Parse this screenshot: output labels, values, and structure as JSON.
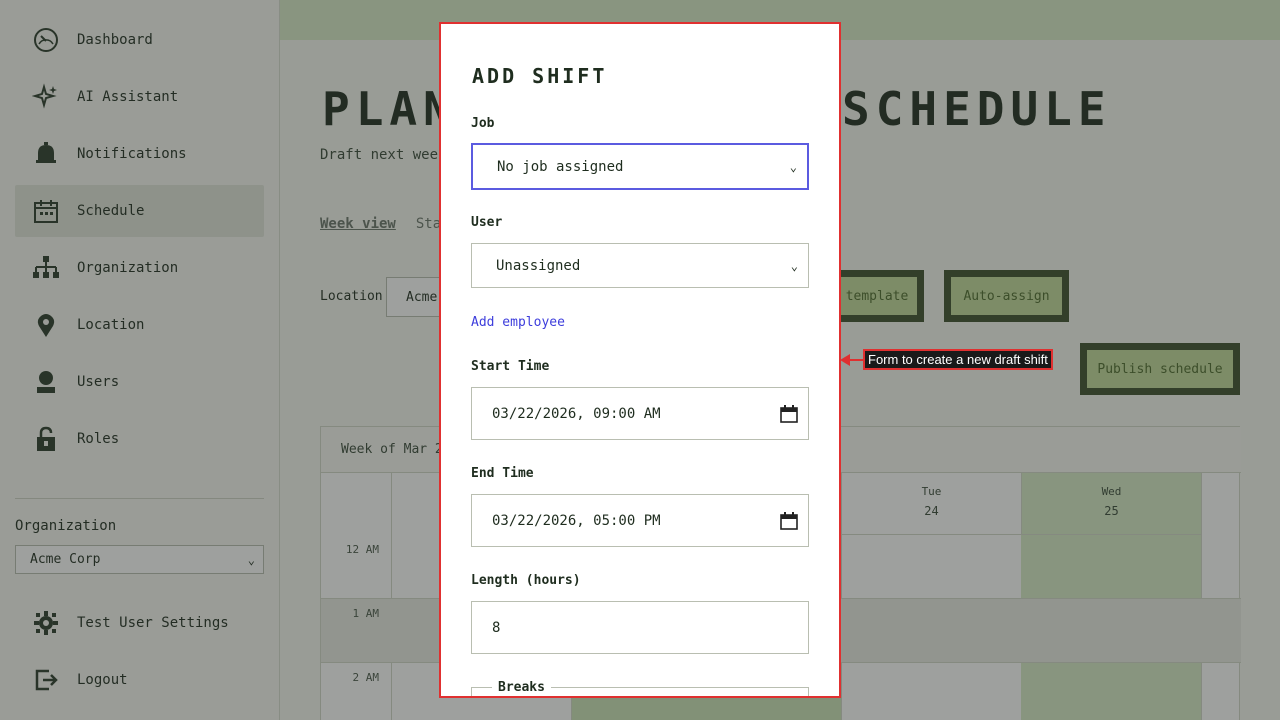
{
  "sidebar": {
    "items": [
      {
        "label": "Dashboard",
        "icon": "dashboard-icon"
      },
      {
        "label": "AI Assistant",
        "icon": "sparkle-icon"
      },
      {
        "label": "Notifications",
        "icon": "bell-icon"
      },
      {
        "label": "Schedule",
        "icon": "calendar-icon",
        "active": true
      },
      {
        "label": "Organization",
        "icon": "org-chart-icon"
      },
      {
        "label": "Location",
        "icon": "location-pin-icon"
      },
      {
        "label": "Users",
        "icon": "user-icon"
      },
      {
        "label": "Roles",
        "icon": "lock-icon"
      }
    ],
    "org_label": "Organization",
    "org_value": "Acme Corp",
    "settings_label": "Test User Settings",
    "logout_label": "Logout"
  },
  "main": {
    "title_left": "PLAN",
    "title_right": "SCHEDULE",
    "subtitle": "Draft next week",
    "tabs": [
      "Week view",
      "Staf"
    ],
    "location_label": "Location",
    "location_value": "Acme",
    "buttons": {
      "template": "template",
      "auto_assign": "Auto-assign",
      "publish": "Publish schedule"
    },
    "week_label": "Week of Mar 22",
    "days": [
      {
        "name": "Tue",
        "num": "24"
      },
      {
        "name": "Wed",
        "num": "25"
      }
    ],
    "hours": [
      "12 AM",
      "1 AM",
      "2 AM"
    ]
  },
  "modal": {
    "title": "ADD SHIFT",
    "job_label": "Job",
    "job_value": "No job assigned",
    "user_label": "User",
    "user_value": "Unassigned",
    "add_employee": "Add employee",
    "start_label": "Start Time",
    "start_value": "03/22/2026, 09:00 AM",
    "end_label": "End Time",
    "end_value": "03/22/2026, 05:00 PM",
    "length_label": "Length (hours)",
    "length_value": "8",
    "breaks_label": "Breaks"
  },
  "annotation": {
    "text": "Form to create a new draft shift",
    "color": "#e03030"
  },
  "colors": {
    "accent_green": "#c4da9c",
    "dark_green": "#3c4f2c",
    "focus_blue": "#5b5be0",
    "link_blue": "#3d3ddc"
  }
}
